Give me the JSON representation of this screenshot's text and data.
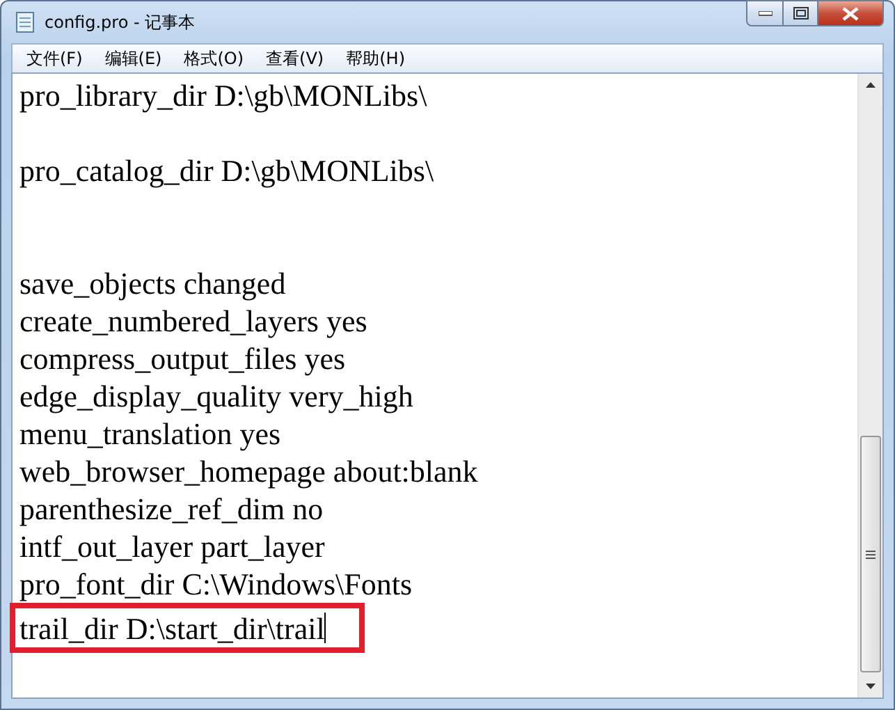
{
  "window": {
    "title": "config.pro - 记事本"
  },
  "menu": [
    "文件(F)",
    "编辑(E)",
    "格式(O)",
    "查看(V)",
    "帮助(H)"
  ],
  "lines": [
    {
      "kind": "text",
      "text": "pro_library_dir D:\\gb\\MONLibs\\",
      "highlighted": false,
      "caret": false
    },
    {
      "kind": "blank"
    },
    {
      "kind": "text",
      "text": "pro_catalog_dir D:\\gb\\MONLibs\\",
      "highlighted": false,
      "caret": false
    },
    {
      "kind": "blank"
    },
    {
      "kind": "blank"
    },
    {
      "kind": "text",
      "text": "save_objects changed",
      "highlighted": false,
      "caret": false
    },
    {
      "kind": "text",
      "text": "create_numbered_layers yes",
      "highlighted": false,
      "caret": false
    },
    {
      "kind": "text",
      "text": "compress_output_files yes",
      "highlighted": false,
      "caret": false
    },
    {
      "kind": "text",
      "text": "edge_display_quality very_high",
      "highlighted": false,
      "caret": false
    },
    {
      "kind": "text",
      "text": "menu_translation yes",
      "highlighted": false,
      "caret": false
    },
    {
      "kind": "text",
      "text": "web_browser_homepage about:blank",
      "highlighted": false,
      "caret": false
    },
    {
      "kind": "text",
      "text": "parenthesize_ref_dim no",
      "highlighted": false,
      "caret": false
    },
    {
      "kind": "text",
      "text": "intf_out_layer part_layer",
      "highlighted": false,
      "caret": false
    },
    {
      "kind": "text",
      "text": "pro_font_dir C:\\Windows\\Fonts",
      "highlighted": false,
      "caret": false
    },
    {
      "kind": "text",
      "text": "trail_dir D:\\start_dir\\trail",
      "highlighted": true,
      "caret": true
    }
  ]
}
